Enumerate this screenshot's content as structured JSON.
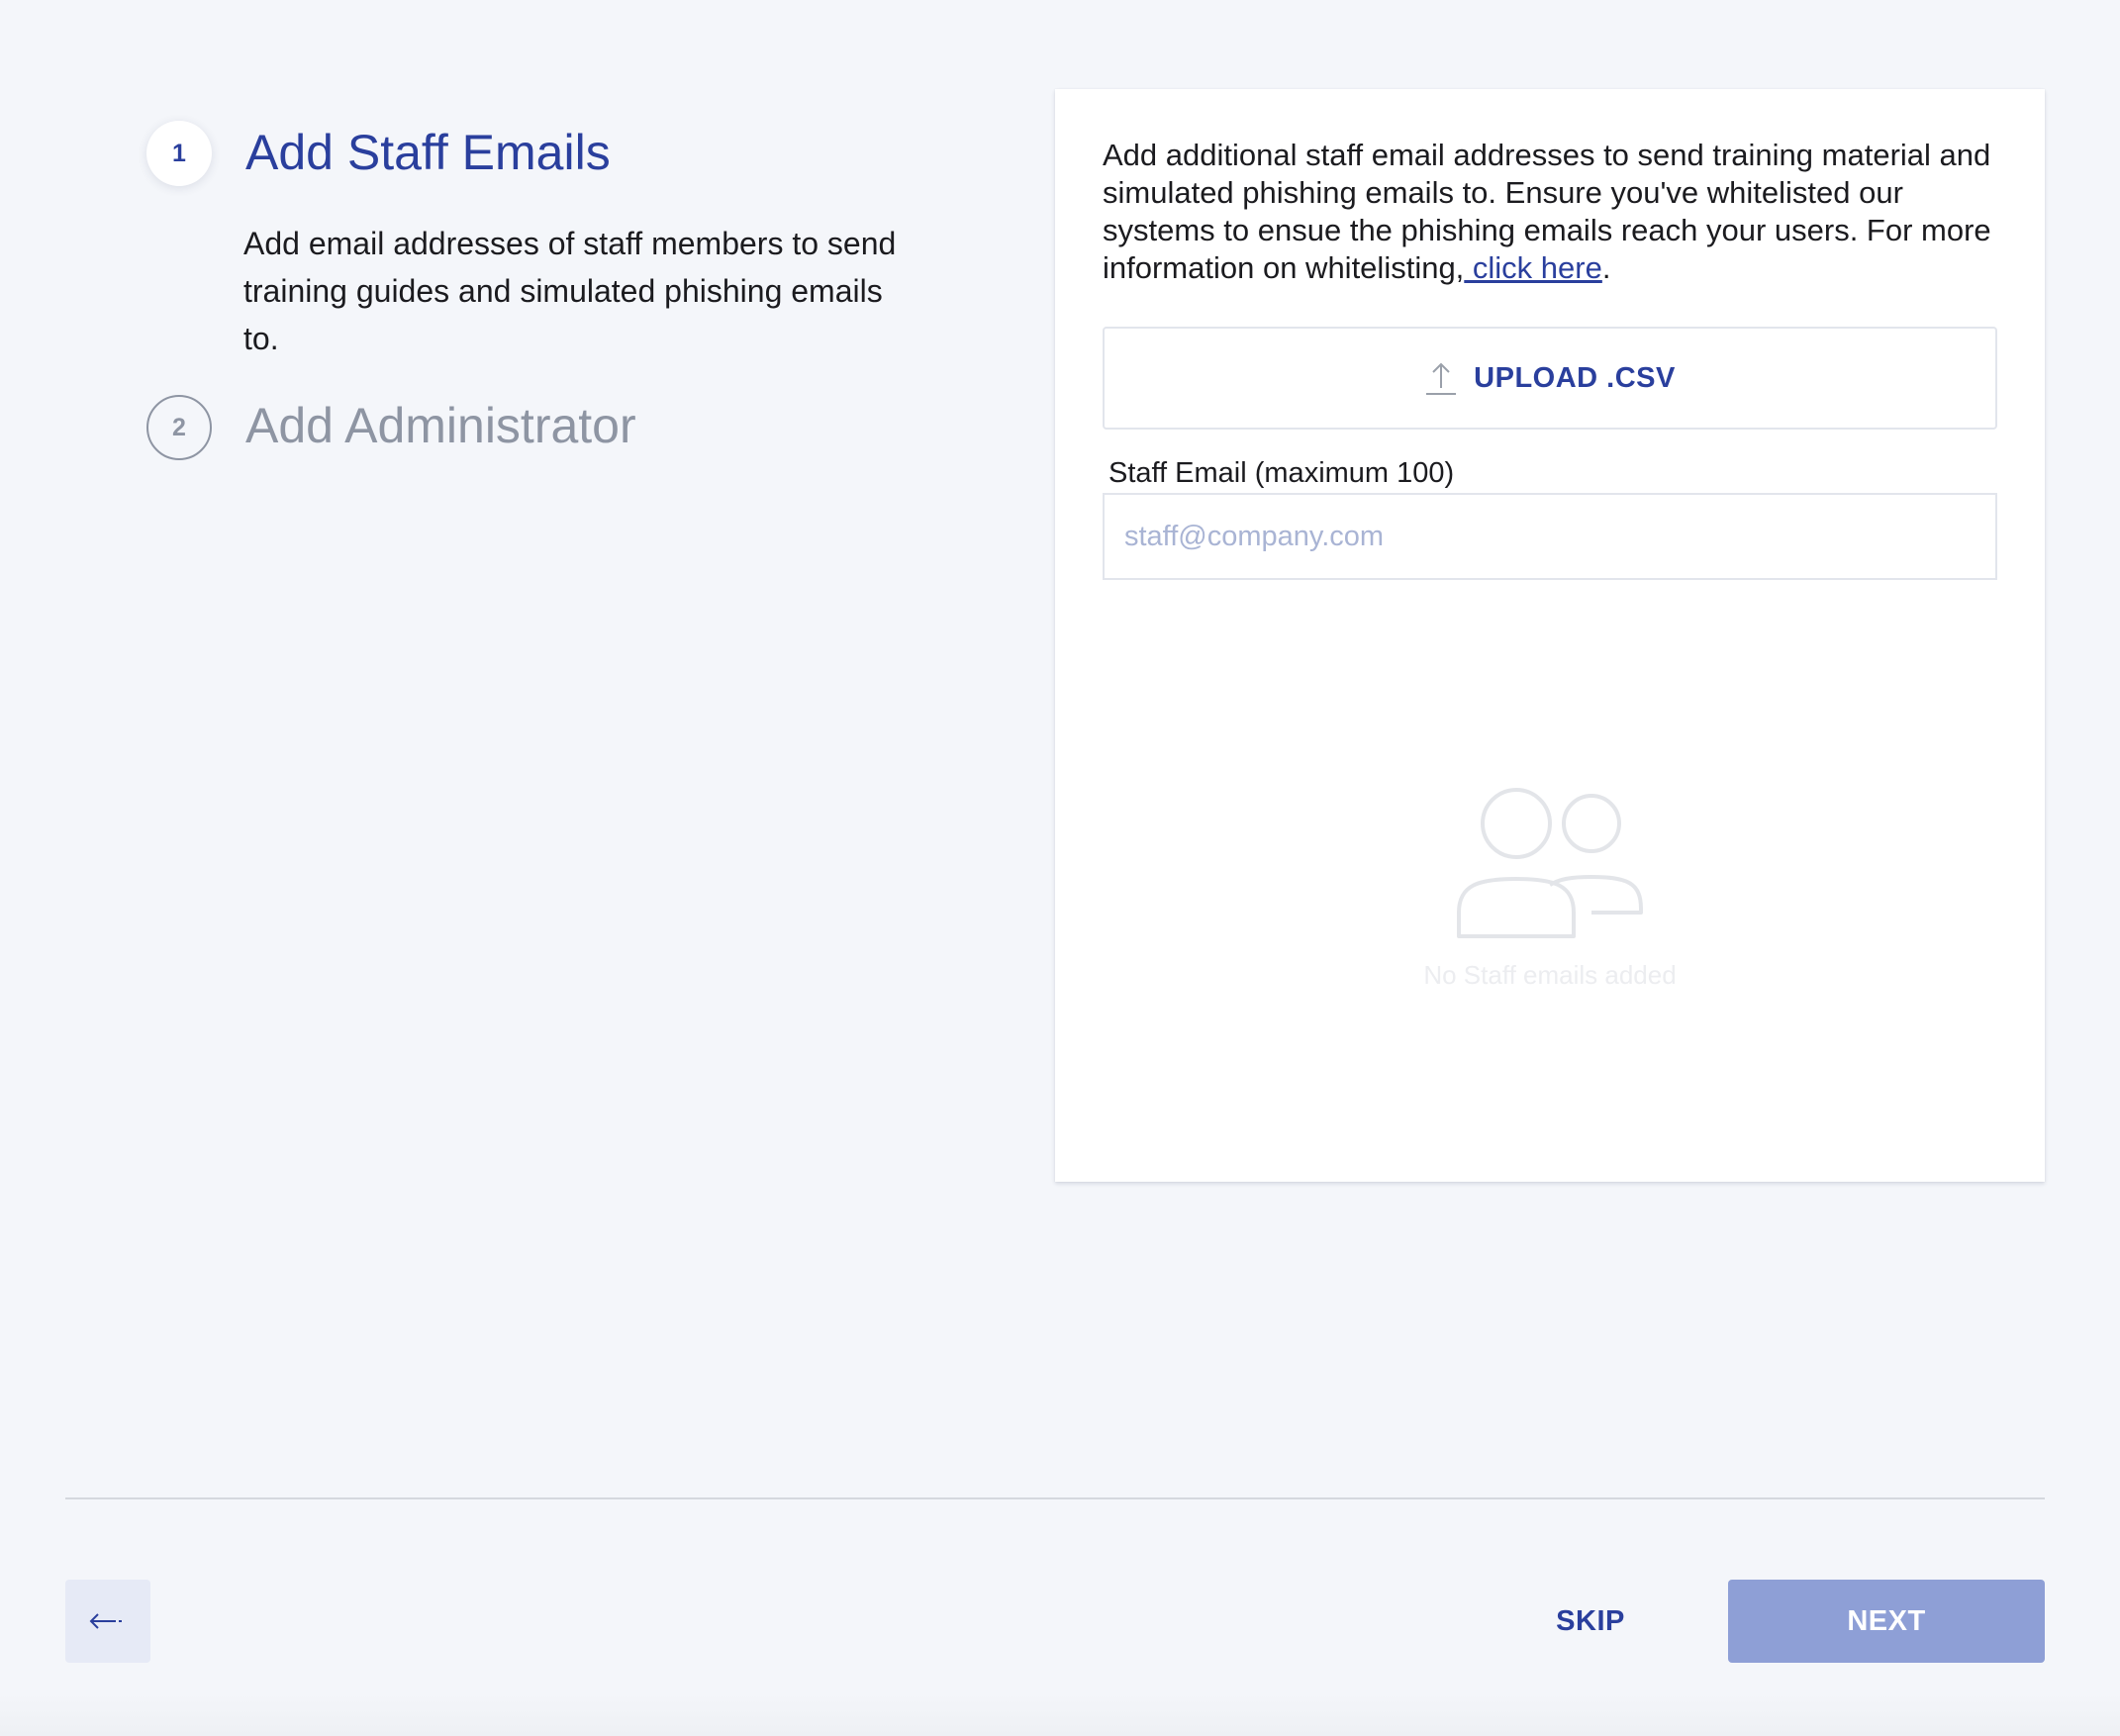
{
  "stepper": {
    "steps": [
      {
        "number": "1",
        "title": "Add Staff Emails",
        "description": "Add email addresses of staff members to send training guides and simulated phishing emails to.",
        "state": "active"
      },
      {
        "number": "2",
        "title": "Add Administrator",
        "state": "inactive"
      }
    ]
  },
  "card": {
    "intro_text": "Add additional staff email addresses to send training material and simulated phishing emails to. Ensure you've whitelisted our systems to ensue the phishing emails reach your users. For more information on whitelisting,",
    "intro_link": " click here",
    "intro_end": ".",
    "upload_label": "UPLOAD .CSV",
    "upload_icon": "upload-icon",
    "field_label": "Staff Email (maximum 100)",
    "email_placeholder": "staff@company.com",
    "email_value": "",
    "empty_icon": "users-icon",
    "empty_text": "No Staff emails added"
  },
  "footer": {
    "back_icon": "arrow-left-icon",
    "skip_label": "SKIP",
    "next_label": "NEXT"
  },
  "colors": {
    "brand": "#2a3f9d",
    "inactive": "#8e95a3",
    "next_button": "#8e9fd6",
    "background": "#f4f6fa"
  }
}
